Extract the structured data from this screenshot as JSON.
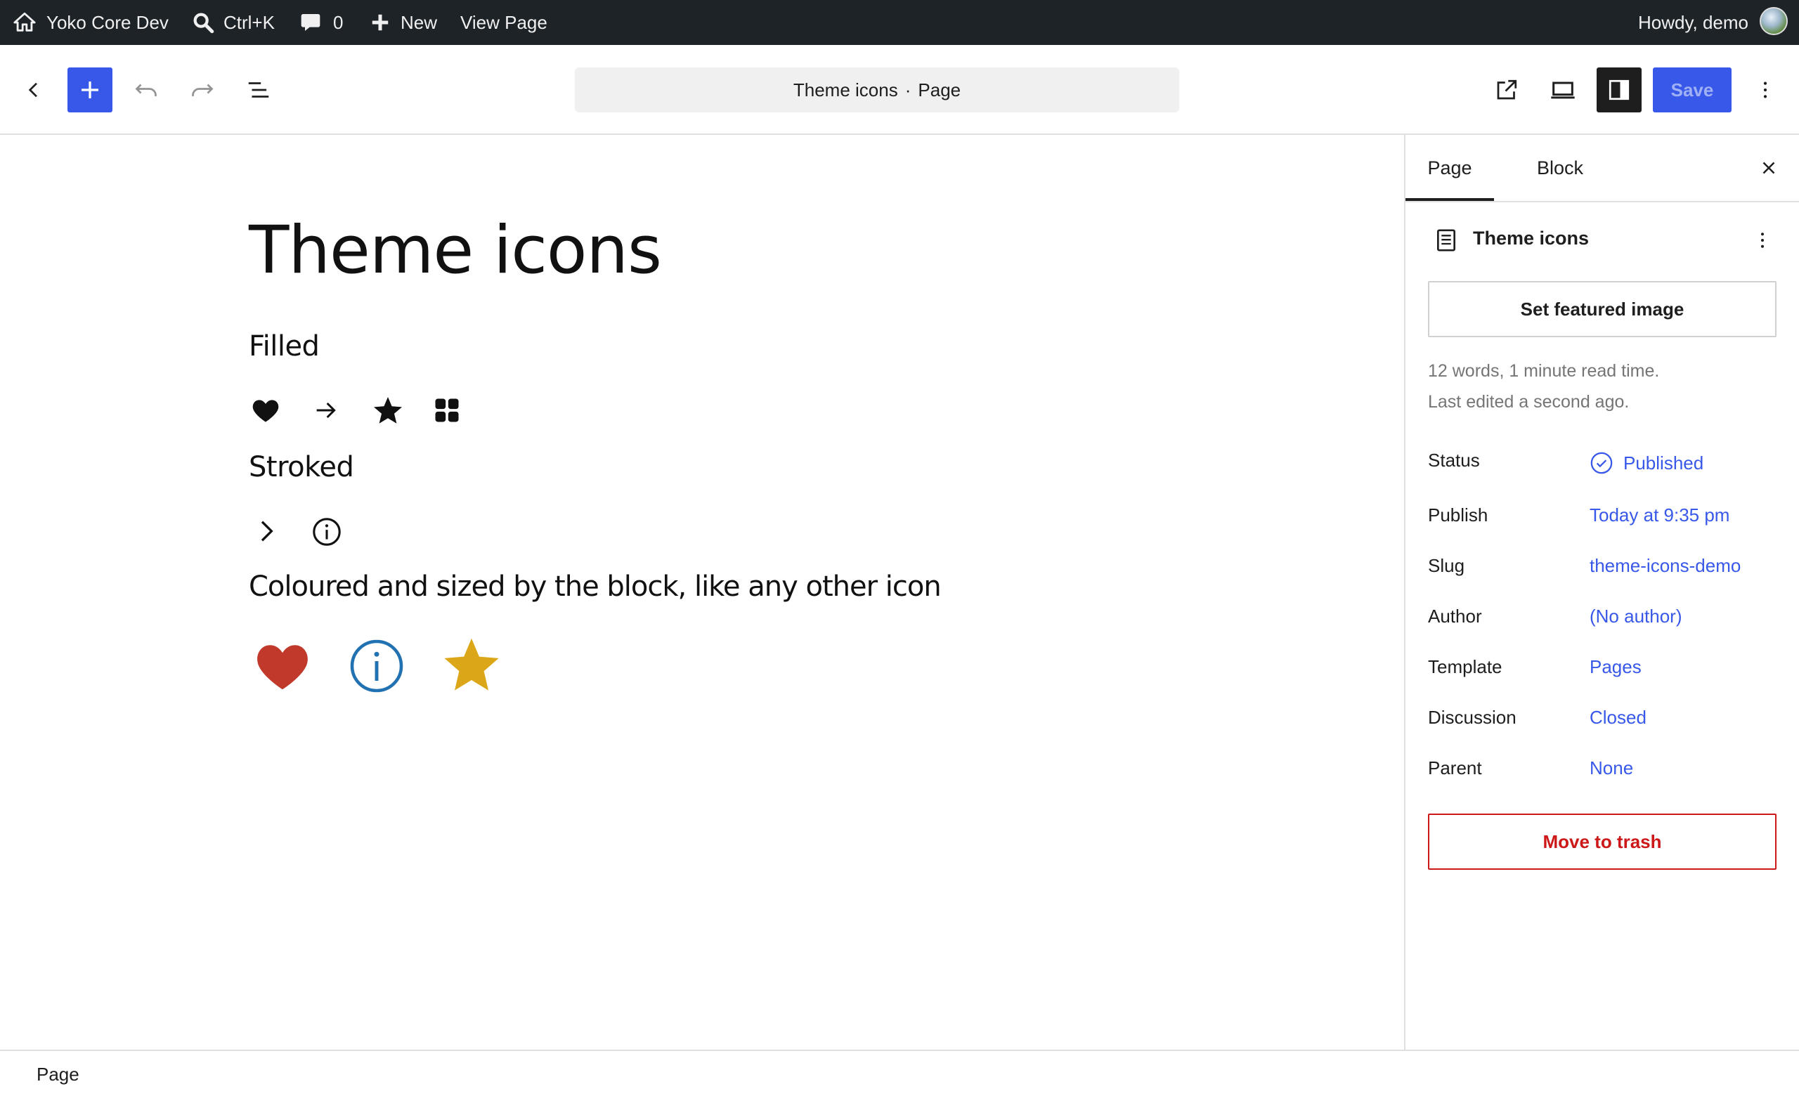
{
  "admin_bar": {
    "site_name": "Yoko Core Dev",
    "search_shortcut": "Ctrl+K",
    "comments_count": "0",
    "new_label": "New",
    "view_page_label": "View Page",
    "greeting": "Howdy, demo"
  },
  "editor_header": {
    "doc_title": "Theme icons",
    "separator": "·",
    "doc_type": "Page",
    "save_label": "Save"
  },
  "content": {
    "title": "Theme icons",
    "sections": [
      {
        "heading": "Filled",
        "icons": [
          "heart-icon",
          "arrow-right-icon",
          "star-icon",
          "grid-icon"
        ]
      },
      {
        "heading": "Stroked",
        "icons": [
          "chevron-right-icon",
          "info-icon"
        ]
      },
      {
        "heading": "Coloured and sized by the block, like any other icon",
        "icons": [
          "heart-icon",
          "info-icon",
          "star-icon"
        ]
      }
    ],
    "colours": {
      "heart": "#c0392b",
      "info": "#2271b1",
      "star": "#dba617"
    }
  },
  "sidebar": {
    "tabs": [
      "Page",
      "Block"
    ],
    "active_tab": "Page",
    "doc_title": "Theme icons",
    "featured_image_label": "Set featured image",
    "word_count_text": "12 words, 1 minute read time.",
    "last_edited_text": "Last edited a second ago.",
    "rows": [
      {
        "label": "Status",
        "value": "Published"
      },
      {
        "label": "Publish",
        "value": "Today at 9:35 pm"
      },
      {
        "label": "Slug",
        "value": "theme-icons-demo"
      },
      {
        "label": "Author",
        "value": "(No author)"
      },
      {
        "label": "Template",
        "value": "Pages"
      },
      {
        "label": "Discussion",
        "value": "Closed"
      },
      {
        "label": "Parent",
        "value": "None"
      }
    ],
    "trash_label": "Move to trash"
  },
  "footer": {
    "breadcrumb": "Page"
  },
  "colors": {
    "accent": "#3858e9",
    "admin_bar": "#1d2327",
    "danger": "#cc1818"
  }
}
